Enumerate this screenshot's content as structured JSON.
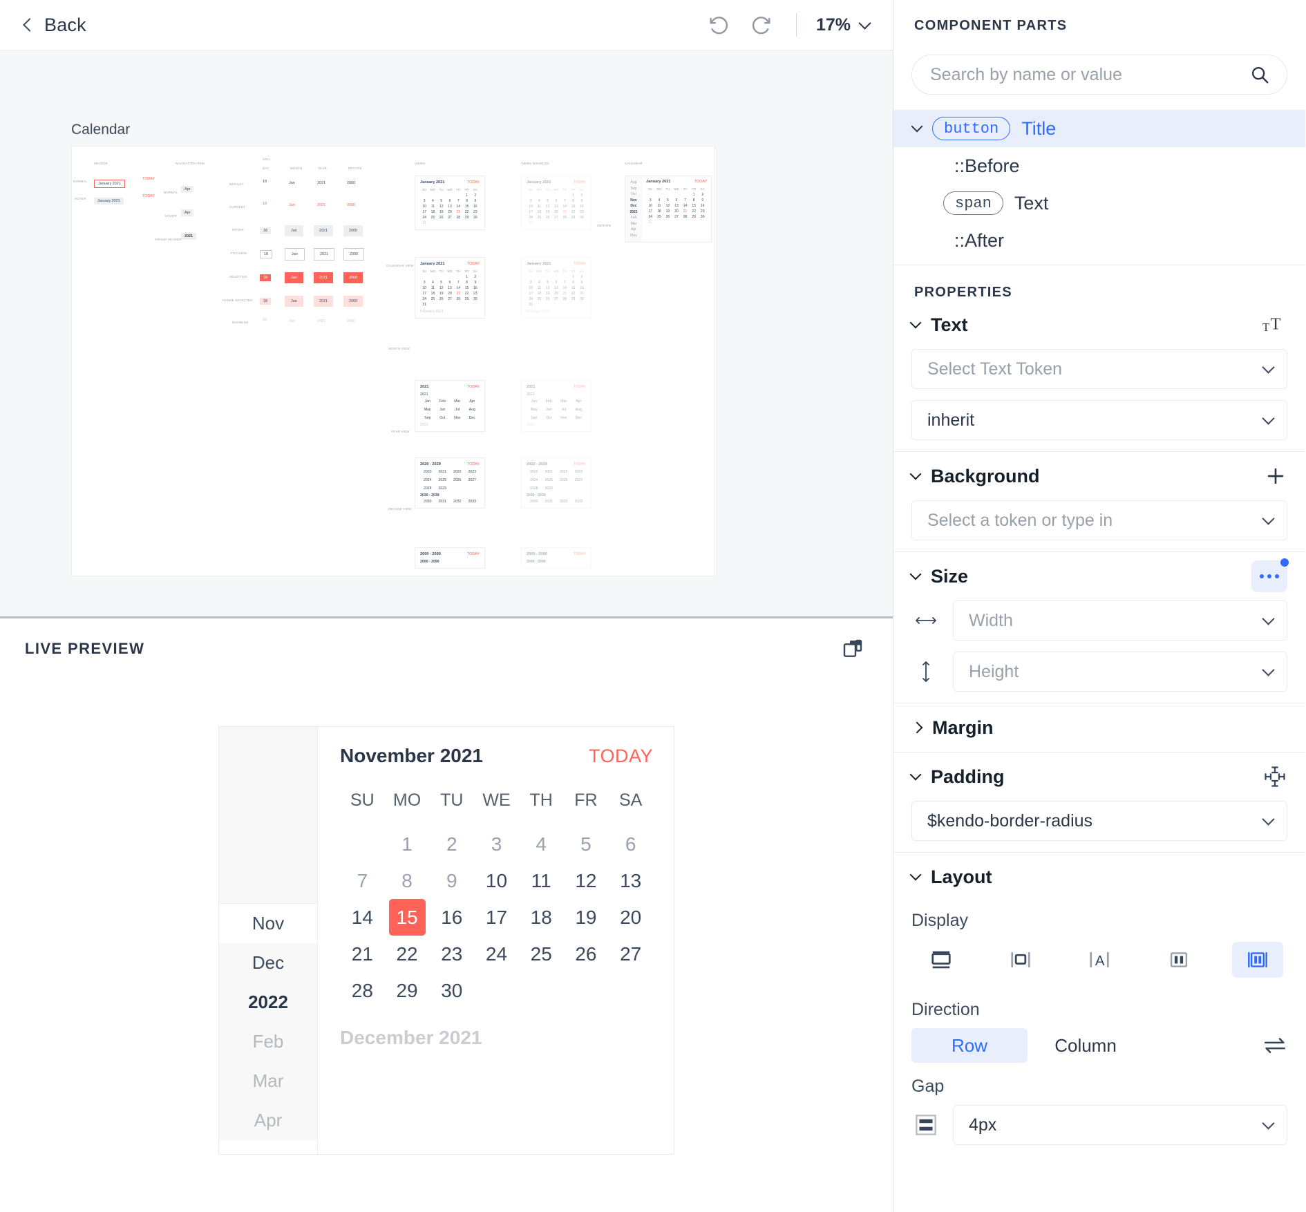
{
  "topbar": {
    "back_label": "Back",
    "undo_icon": "undo-icon",
    "redo_icon": "redo-icon",
    "zoom_value": "17%"
  },
  "canvas": {
    "artboard_label": "Calendar",
    "spec": {
      "sections": [
        "HEADER",
        "NAVIGATION ITEM",
        "CELL",
        "VIEWS",
        "VIEWS DISABLED",
        "CALENDAR"
      ],
      "header_states": [
        "NORMAL",
        "HOVER"
      ],
      "header_title": "January 2021",
      "header_today": "TODAY",
      "nav_states": [
        "NORMAL",
        "HOVER",
        "GROUP HEADER"
      ],
      "nav_values": [
        "Apr",
        "Apr",
        "2021"
      ],
      "cell_columns": [
        "DAY",
        "MONTH",
        "YEAR",
        "DECADE"
      ],
      "cell_states": [
        "DEFAULT",
        "CURRENT",
        "HOVER",
        "FOCUSED",
        "SELECTED",
        "RANGE SELECTED",
        "DISABLED"
      ],
      "cell_values": [
        "18",
        "Jan",
        "2021",
        "2000"
      ],
      "view_labels": [
        "CALENDAR VIEW",
        "MONTH VIEW",
        "YEAR VIEW",
        "DECADE VIEW",
        "INFINITE"
      ],
      "month_title": "January 2021",
      "next_month_title": "February 2021",
      "today_label": "TODAY",
      "dow": [
        "SU",
        "MO",
        "TU",
        "WE",
        "TH",
        "FR",
        "SA"
      ],
      "year_title": "2021",
      "year_rows": [
        [
          "Jan",
          "Feb",
          "Mar",
          "Apr"
        ],
        [
          "May",
          "Jun",
          "Jul",
          "Aug"
        ],
        [
          "Sep",
          "Oct",
          "Nov",
          "Dec"
        ]
      ],
      "year_prev": "2021",
      "year_next": "2022",
      "decade_title": "2020 - 2029",
      "decade_rows": [
        [
          "2020",
          "2021",
          "2022",
          "2023"
        ],
        [
          "2024",
          "2025",
          "2026",
          "2027"
        ],
        [
          "2028",
          "2029",
          "",
          ""
        ]
      ],
      "decade_next_title": "2030 - 2039",
      "decade_next_row": [
        "2030",
        "2031",
        "2032",
        "2033"
      ],
      "century_title": "2000 - 2090",
      "century_sub": "2000 - 2090",
      "infinite_months": [
        "Aug",
        "Sep",
        "Oct",
        "Nov",
        "Dec",
        "2021",
        "Feb",
        "Mar",
        "Apr",
        "May"
      ]
    }
  },
  "preview": {
    "title": "LIVE PREVIEW",
    "popout_icon": "open-in-new-window-icon"
  },
  "calendar": {
    "month_title": "November 2021",
    "today_label": "TODAY",
    "next_month_title": "December 2021",
    "dow": [
      "SU",
      "MO",
      "TU",
      "WE",
      "TH",
      "FR",
      "SA"
    ],
    "weeks": [
      [
        "",
        "1",
        "2",
        "3",
        "4",
        "5",
        "6"
      ],
      [
        "7",
        "8",
        "9",
        "10",
        "11",
        "12",
        "13"
      ],
      [
        "14",
        "15",
        "16",
        "17",
        "18",
        "19",
        "20"
      ],
      [
        "21",
        "22",
        "23",
        "24",
        "25",
        "26",
        "27"
      ],
      [
        "28",
        "29",
        "30",
        "",
        "",
        "",
        ""
      ]
    ],
    "muted_days": [
      "1",
      "2",
      "3",
      "4",
      "5",
      "6",
      "7",
      "8",
      "9"
    ],
    "selected_day": "15",
    "selected_color": "#ff6358",
    "side_months": [
      "Nov",
      "Dec",
      "2022",
      "Feb",
      "Mar",
      "Apr"
    ],
    "side_current": "2022"
  },
  "component_parts": {
    "title": "COMPONENT PARTS",
    "search_placeholder": "Search by name or value",
    "search_value": "",
    "search_icon": "search-icon",
    "tree": [
      {
        "tag": "button",
        "label": "Title",
        "selected": true,
        "expanded": true
      },
      {
        "tag": "",
        "label": "::Before",
        "selected": false
      },
      {
        "tag": "span",
        "label": "Text",
        "selected": false
      },
      {
        "tag": "",
        "label": "::After",
        "selected": false
      }
    ]
  },
  "properties": {
    "title": "PROPERTIES",
    "text": {
      "name": "Text",
      "action_icon": "typography-icon",
      "token_placeholder": "Select Text Token",
      "token_value": "",
      "color_value": "inherit"
    },
    "background": {
      "name": "Background",
      "action_icon": "plus-icon",
      "token_placeholder": "Select a token or type in",
      "token_value": ""
    },
    "size": {
      "name": "Size",
      "action_icon": "more-options-icon",
      "width_placeholder": "Width",
      "width_value": "",
      "height_placeholder": "Height",
      "height_value": "",
      "width_icon": "horizontal-arrows-icon",
      "height_icon": "vertical-arrows-icon"
    },
    "margin": {
      "name": "Margin",
      "expanded": false
    },
    "padding": {
      "name": "Padding",
      "action_icon": "padding-icon",
      "value": "$kendo-border-radius"
    },
    "layout": {
      "name": "Layout",
      "display_label": "Display",
      "display_options": [
        "block",
        "inline-block",
        "inline",
        "flex",
        "inline-flex"
      ],
      "display_selected_index": 4,
      "direction_label": "Direction",
      "direction_options": [
        "Row",
        "Column"
      ],
      "direction_selected": "Row",
      "direction_swap_icon": "swap-icon",
      "gap_label": "Gap",
      "gap_value": "4px",
      "gap_icon": "gap-icon"
    }
  }
}
